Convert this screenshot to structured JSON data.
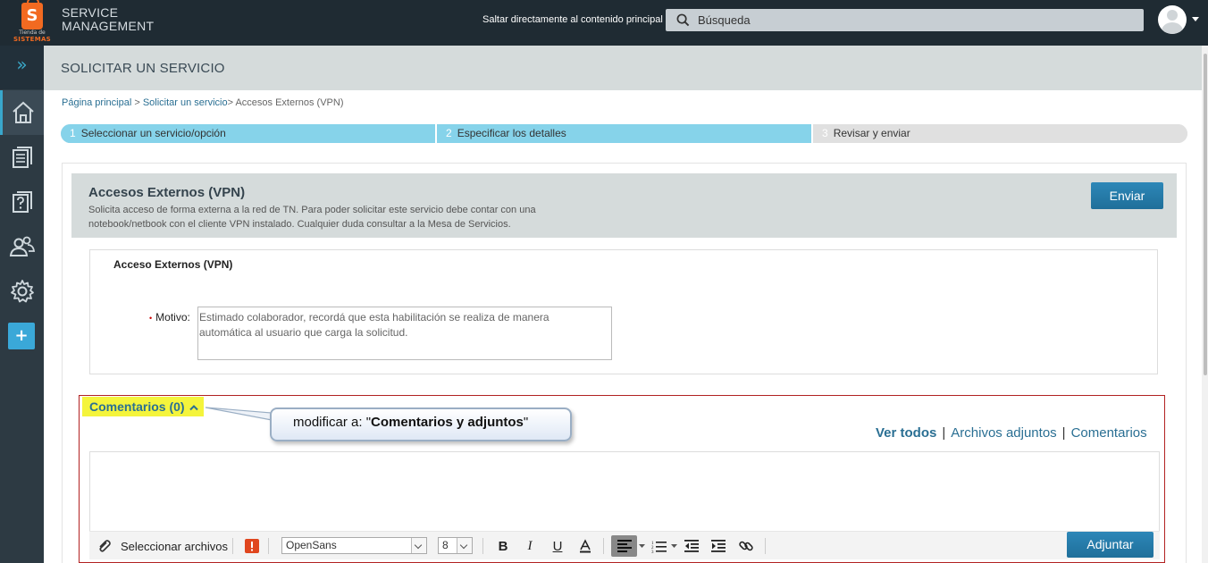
{
  "logo": {
    "letter": "S",
    "line1": "Tienda de",
    "line2": "SISTEMAS"
  },
  "brand": {
    "line1": "SERVICE",
    "line2": "MANAGEMENT"
  },
  "header": {
    "skip_link": "Saltar directamente al contenido principal"
  },
  "search": {
    "placeholder": "Búsqueda"
  },
  "sidebar": {
    "toggle": "»",
    "add": "+"
  },
  "page": {
    "title": "SOLICITAR UN SERVICIO"
  },
  "breadcrumb": {
    "home": "Página principal",
    "sep1": " > ",
    "request": "Solicitar un servicio",
    "current": "> Accesos Externos (VPN)"
  },
  "steps": [
    {
      "num": "1",
      "label": "Seleccionar un servicio/opción"
    },
    {
      "num": "2",
      "label": "Especificar los detalles"
    },
    {
      "num": "3",
      "label": "Revisar y enviar"
    }
  ],
  "service": {
    "title": "Accesos Externos (VPN)",
    "description_line1": "Solicita acceso de forma externa a la red de TN. Para poder solicitar este servicio debe contar con una",
    "description_line2": "notebook/netbook con el cliente VPN instalado. Cualquier duda consultar a la Mesa de Servicios.",
    "submit_label": "Enviar"
  },
  "form": {
    "section_title": "Acceso Externos (VPN)",
    "required_mark": "•",
    "motivo_label": "Motivo:",
    "motivo_value_line1": "Estimado colaborador, recordá que esta habilitación se realiza de manera",
    "motivo_value_line2": "automática al usuario que carga la solicitud."
  },
  "comments": {
    "title": "Comentarios (0)",
    "callout_prefix": "modificar a: \"",
    "callout_bold": "Comentarios y adjuntos",
    "callout_suffix": "\"",
    "filters": {
      "all": "Ver todos",
      "attachments": "Archivos adjuntos",
      "comments": "Comentarios",
      "sep": "|"
    },
    "toolbar": {
      "select_files": "Seleccionar archivos",
      "font": "OpenSans",
      "size": "8",
      "bold": "B",
      "italic": "I",
      "underline": "U"
    },
    "attach_label": "Adjuntar"
  },
  "colors": {
    "topbar": "#1f2b33",
    "sidebar": "#2d3a43",
    "accent": "#2a6f93",
    "step_done": "#86d3ea",
    "highlight": "#f4f43c",
    "frame_red": "#b22222"
  }
}
